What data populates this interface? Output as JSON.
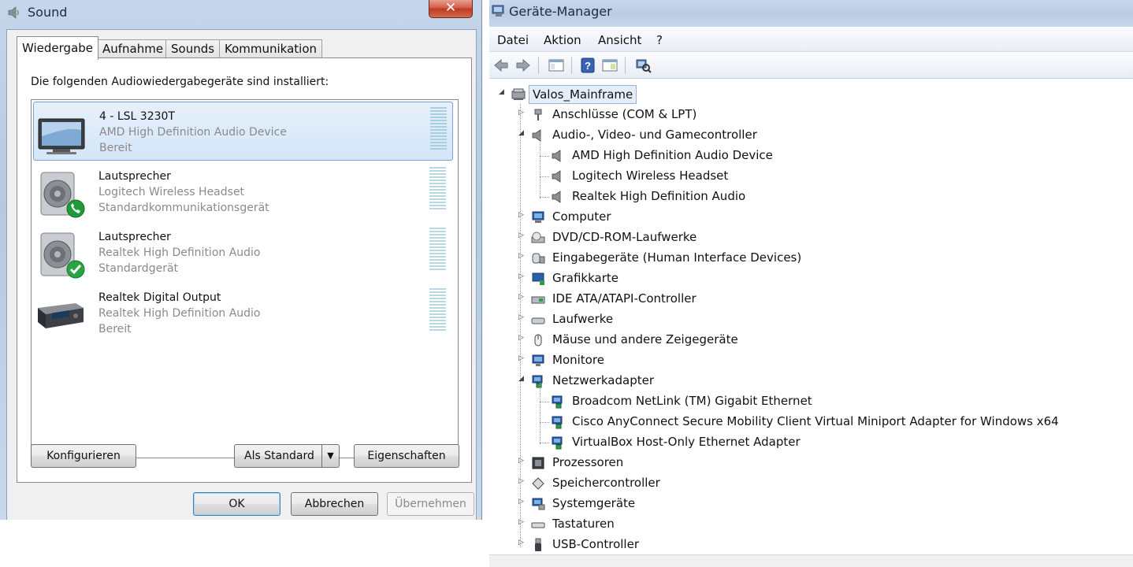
{
  "sound_dialog": {
    "title": "Sound",
    "close_glyph": "✕",
    "tabs": [
      {
        "label": "Wiedergabe",
        "active": true
      },
      {
        "label": "Aufnahme",
        "active": false
      },
      {
        "label": "Sounds",
        "active": false
      },
      {
        "label": "Kommunikation",
        "active": false
      }
    ],
    "intro_text": "Die folgenden Audiowiedergabegeräte sind installiert:",
    "devices": [
      {
        "name": "4 - LSL 3230T",
        "driver": "AMD High Definition Audio Device",
        "status": "Bereit",
        "icon": "monitor-icon",
        "selected": true
      },
      {
        "name": "Lautsprecher",
        "driver": "Logitech Wireless Headset",
        "status": "Standardkommunikationsgerät",
        "icon": "speaker-phone-icon",
        "selected": false
      },
      {
        "name": "Lautsprecher",
        "driver": "Realtek High Definition Audio",
        "status": "Standardgerät",
        "icon": "speaker-default-icon",
        "selected": false
      },
      {
        "name": "Realtek Digital Output",
        "driver": "Realtek High Definition Audio",
        "status": "Bereit",
        "icon": "digital-output-icon",
        "selected": false
      }
    ],
    "buttons": {
      "configure": "Konfigurieren",
      "set_default": "Als Standard",
      "set_default_arrow": "▼",
      "properties": "Eigenschaften",
      "ok": "OK",
      "cancel": "Abbrechen",
      "apply": "Übernehmen"
    }
  },
  "device_manager": {
    "title": "Geräte-Manager",
    "menu": [
      "Datei",
      "Aktion",
      "Ansicht",
      "?"
    ],
    "toolbar_icons": [
      "back-arrow-icon",
      "forward-arrow-icon",
      "show-hide-console-tree-icon",
      "help-icon",
      "properties-view-icon",
      "scan-hardware-icon"
    ],
    "root": {
      "label": "Valos_Mainframe",
      "icon": "computer-tree-root-icon"
    },
    "categories": [
      {
        "label": "Anschlüsse (COM & LPT)",
        "icon": "port-icon",
        "expanded": false
      },
      {
        "label": "Audio-, Video- und Gamecontroller",
        "icon": "audio-speaker-icon",
        "expanded": true,
        "children": [
          "AMD High Definition Audio Device",
          "Logitech Wireless Headset",
          "Realtek High Definition Audio"
        ]
      },
      {
        "label": "Computer",
        "icon": "computer-icon",
        "expanded": false
      },
      {
        "label": "DVD/CD-ROM-Laufwerke",
        "icon": "dvd-drive-icon",
        "expanded": false
      },
      {
        "label": "Eingabegeräte (Human Interface Devices)",
        "icon": "hid-icon",
        "expanded": false
      },
      {
        "label": "Grafikkarte",
        "icon": "display-adapter-icon",
        "expanded": false
      },
      {
        "label": "IDE ATA/ATAPI-Controller",
        "icon": "ide-controller-icon",
        "expanded": false
      },
      {
        "label": "Laufwerke",
        "icon": "disk-drive-icon",
        "expanded": false
      },
      {
        "label": "Mäuse und andere Zeigegeräte",
        "icon": "mouse-icon",
        "expanded": false
      },
      {
        "label": "Monitore",
        "icon": "monitor-icon",
        "expanded": false
      },
      {
        "label": "Netzwerkadapter",
        "icon": "network-adapter-icon",
        "expanded": true,
        "children": [
          "Broadcom NetLink (TM) Gigabit Ethernet",
          "Cisco AnyConnect Secure Mobility Client Virtual Miniport Adapter for Windows x64",
          "VirtualBox Host-Only Ethernet Adapter"
        ]
      },
      {
        "label": "Prozessoren",
        "icon": "processor-icon",
        "expanded": false
      },
      {
        "label": "Speichercontroller",
        "icon": "storage-controller-icon",
        "expanded": false
      },
      {
        "label": "Systemgeräte",
        "icon": "system-devices-icon",
        "expanded": false
      },
      {
        "label": "Tastaturen",
        "icon": "keyboard-icon",
        "expanded": false
      },
      {
        "label": "USB-Controller",
        "icon": "usb-icon",
        "expanded": false
      }
    ]
  }
}
